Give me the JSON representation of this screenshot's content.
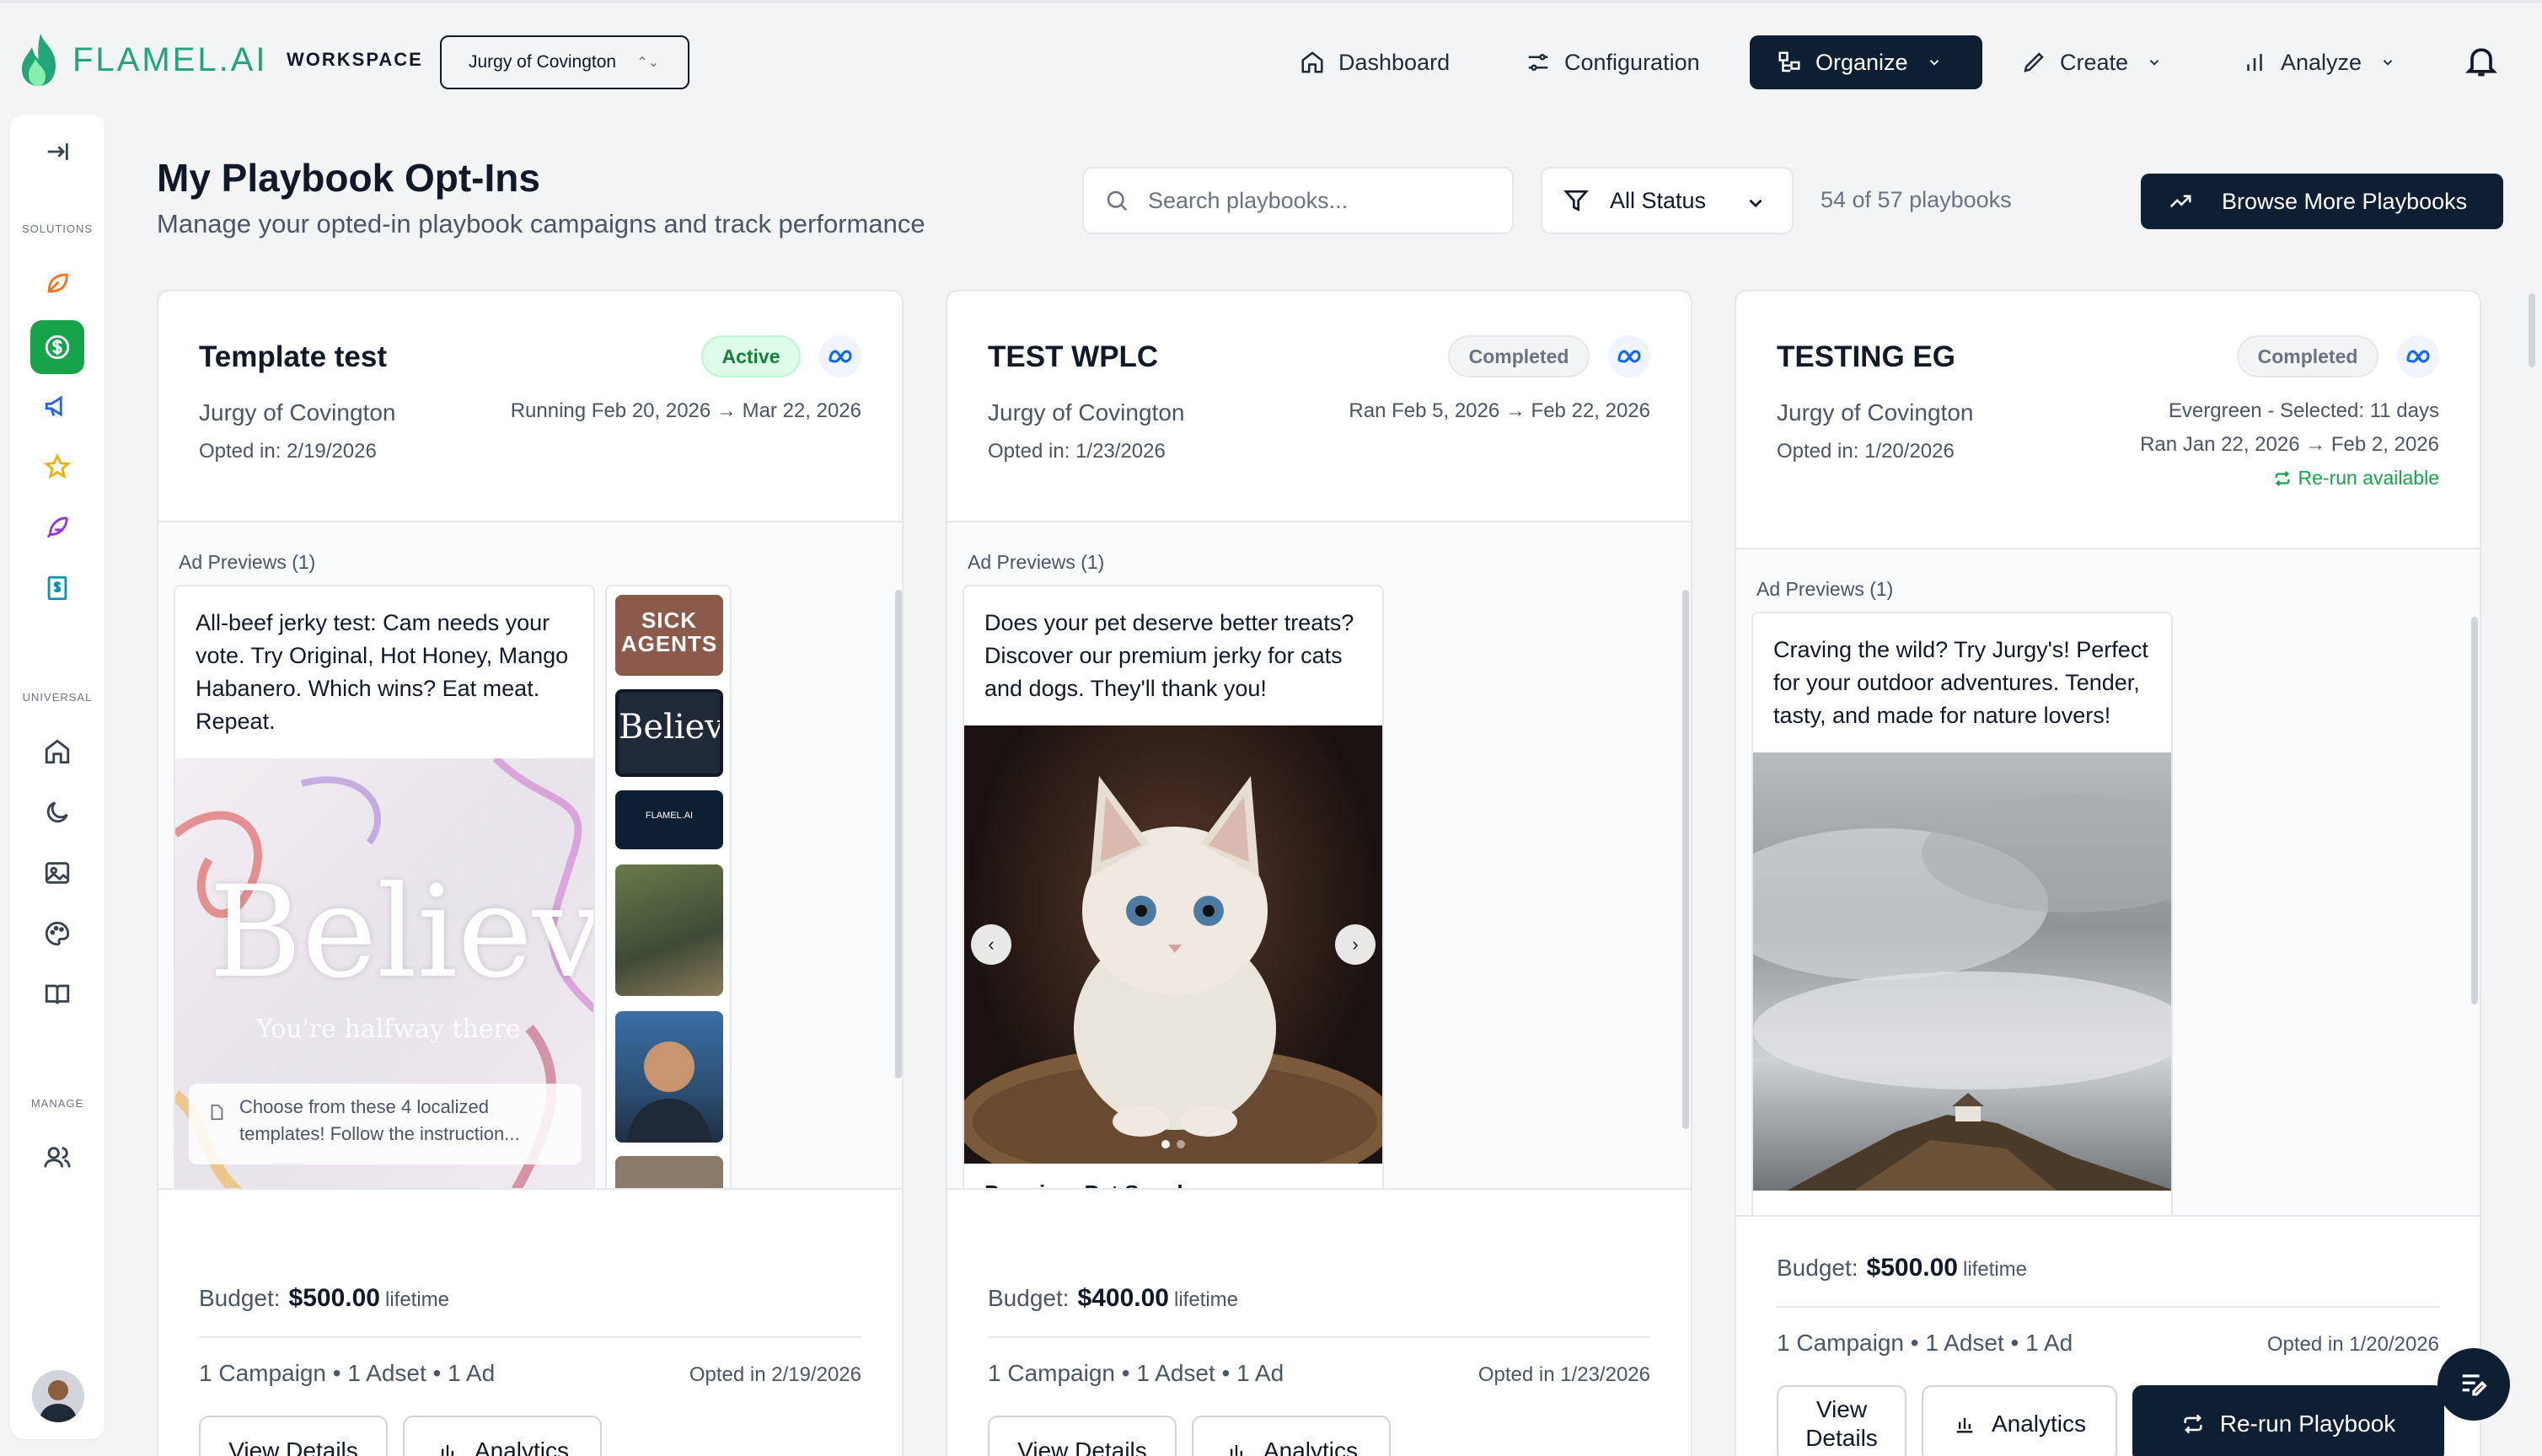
{
  "brand": {
    "name": "FLAMEL.AI",
    "workspace_label": "WORKSPACE",
    "workspace_value": "Jurgy of Covington",
    "accent": "#22a579"
  },
  "nav": {
    "dashboard": "Dashboard",
    "configuration": "Configuration",
    "organize": "Organize",
    "create": "Create",
    "analyze": "Analyze"
  },
  "sidebar": {
    "solutions_label": "SOLUTIONS",
    "universal_label": "UNIVERSAL",
    "manage_label": "MANAGE"
  },
  "header": {
    "title": "My Playbook Opt-Ins",
    "subtitle": "Manage your opted-in playbook campaigns and track performance",
    "search_placeholder": "Search playbooks...",
    "status_filter": "All Status",
    "count": "54 of 57 playbooks",
    "browse_button": "Browse More Playbooks"
  },
  "cards": [
    {
      "title": "Template test",
      "badge": "Active",
      "org": "Jurgy of Covington",
      "opted_in": "Opted in: 2/19/2026",
      "run_line": "Running Feb 20, 2026 → Mar 22, 2026",
      "preview_label": "Ad Previews (1)",
      "ad_text": "All-beef jerky test: Cam needs your vote. Try Original, Hot Honey, Mango Habanero. Which wins? Eat meat. Repeat.",
      "img_title": "Believe",
      "img_sub": "You're halfway there",
      "img_note": "Choose from these 4 localized templates! Follow the instruction...",
      "thumb1": "SICK AGENTS",
      "thumb2": "Believe",
      "thumb3": "FLAMEL.AI",
      "budget_label": "Budget:",
      "budget_value": "$500.00",
      "budget_unit": "lifetime",
      "stats": "1 Campaign • 1 Adset • 1 Ad",
      "opted_date": "Opted in 2/19/2026",
      "view_details": "View Details",
      "analytics": "Analytics"
    },
    {
      "title": "TEST WPLC",
      "badge": "Completed",
      "org": "Jurgy of Covington",
      "opted_in": "Opted in: 1/23/2026",
      "run_line": "Ran Feb 5, 2026 → Feb 22, 2026",
      "preview_label": "Ad Previews (1)",
      "ad_text": "Does your pet deserve better treats? Discover our premium jerky for cats and dogs. They'll thank you!",
      "cut_text": "Premium Pet Snacks",
      "budget_label": "Budget:",
      "budget_value": "$400.00",
      "budget_unit": "lifetime",
      "stats": "1 Campaign • 1 Adset • 1 Ad",
      "opted_date": "Opted in 1/23/2026",
      "view_details": "View Details",
      "analytics": "Analytics"
    },
    {
      "title": "TESTING EG",
      "badge": "Completed",
      "org": "Jurgy of Covington",
      "opted_in": "Opted in: 1/20/2026",
      "run_line1": "Evergreen - Selected: 11 days",
      "run_line2": "Ran Jan 22, 2026 → Feb 2, 2026",
      "rerun_available": "Re-run available",
      "preview_label": "Ad Previews (1)",
      "ad_text": "Craving the wild? Try Jurgy's! Perfect for your outdoor adventures. Tender, tasty, and made for nature lovers!",
      "budget_label": "Budget:",
      "budget_value": "$500.00",
      "budget_unit": "lifetime",
      "stats": "1 Campaign • 1 Adset • 1 Ad",
      "opted_date": "Opted in 1/20/2026",
      "view_details": "View Details",
      "analytics": "Analytics",
      "rerun_button": "Re-run Playbook"
    }
  ],
  "colors": {
    "dark": "#0f1f33",
    "green": "#16a34a",
    "meta_blue": "#0866ff"
  }
}
